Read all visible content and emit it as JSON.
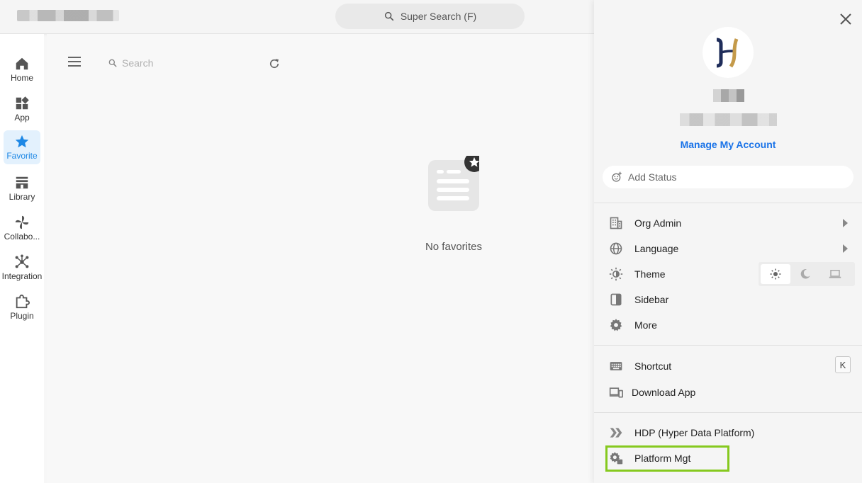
{
  "topbar": {
    "super_search_label": "Super Search (F)"
  },
  "leftnav": {
    "items": [
      {
        "label": "Home",
        "icon": "home-icon"
      },
      {
        "label": "App",
        "icon": "apps-icon"
      },
      {
        "label": "Favorite",
        "icon": "star-icon",
        "active": true
      },
      {
        "label": "Library",
        "icon": "library-icon"
      },
      {
        "label": "Collabo...",
        "icon": "pinwheel-icon"
      },
      {
        "label": "Integration",
        "icon": "integration-icon"
      },
      {
        "label": "Plugin",
        "icon": "plugin-icon"
      }
    ]
  },
  "content": {
    "search_placeholder": "Search",
    "empty_text": "No favorites"
  },
  "panel": {
    "manage_link": "Manage My Account",
    "status_placeholder": "Add Status",
    "menu": {
      "org_admin": "Org Admin",
      "language": "Language",
      "theme": "Theme",
      "sidebar": "Sidebar",
      "more": "More",
      "shortcut": "Shortcut",
      "shortcut_key": "K",
      "download_app": "Download App",
      "hdp": "HDP (Hyper Data Platform)",
      "platform_mgt": "Platform Mgt"
    },
    "theme_options": [
      "light",
      "dark",
      "system"
    ],
    "theme_selected": "light"
  },
  "colors": {
    "accent": "#1e88e5",
    "link": "#1a73e8",
    "highlight": "#86c91f",
    "logo_navy": "#1f2d5a",
    "logo_gold": "#c49a4a"
  }
}
